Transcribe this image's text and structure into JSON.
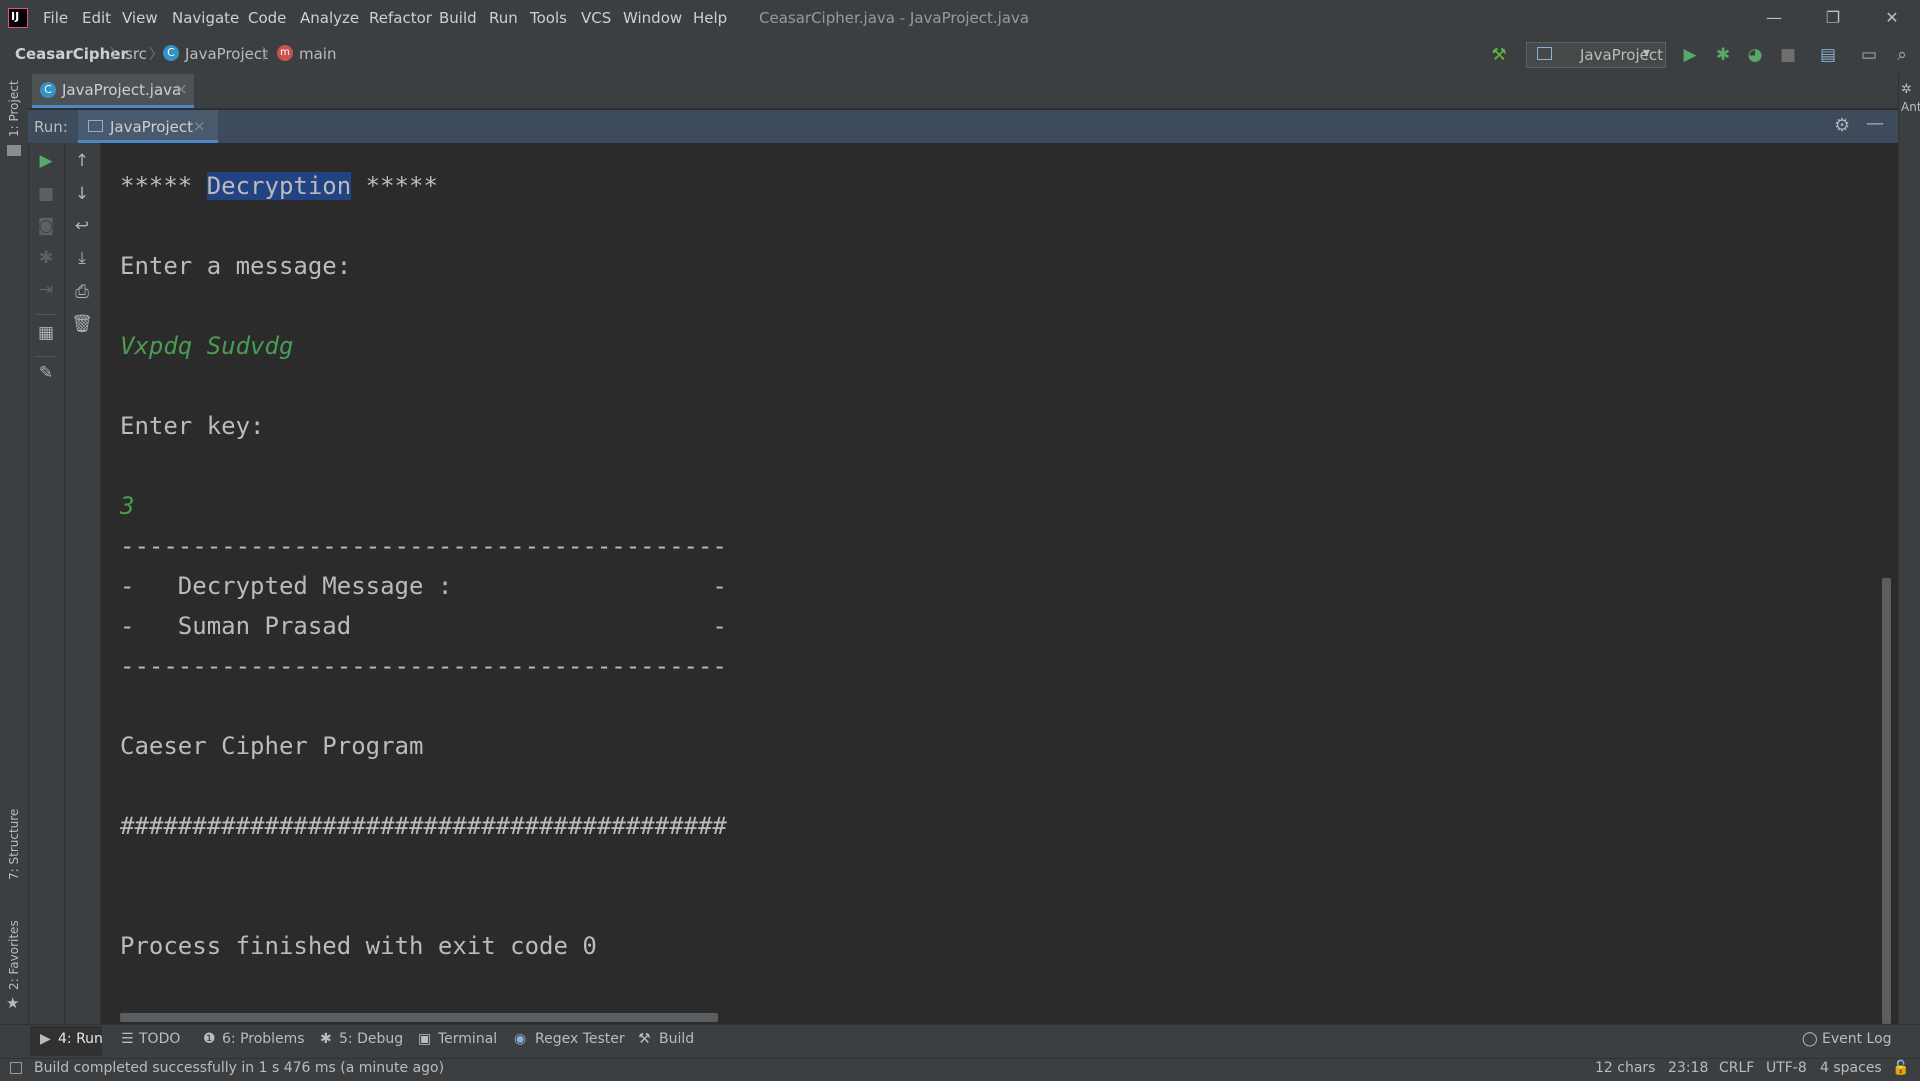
{
  "window": {
    "title": "CeasarCipher.java - JavaProject.java",
    "minimize": "—",
    "restore": "❐",
    "close": "✕"
  },
  "menu": [
    "File",
    "Edit",
    "View",
    "Navigate",
    "Code",
    "Analyze",
    "Refactor",
    "Build",
    "Run",
    "Tools",
    "VCS",
    "Window",
    "Help"
  ],
  "breadcrumb": {
    "project": "CeasarCipher",
    "folder": "src",
    "class": "JavaProject",
    "method": "main"
  },
  "toolbar": {
    "run_config": "JavaProject",
    "dropdown": "▾"
  },
  "editor_tab": {
    "label": "JavaProject.java",
    "close": "×"
  },
  "left_strip": {
    "project": "1: Project",
    "structure": "7: Structure",
    "favorites": "2: Favorites"
  },
  "right_strip": {
    "ant": "Ant"
  },
  "run_window": {
    "label": "Run:",
    "tab": "JavaProject",
    "close": "×"
  },
  "console": {
    "header_prefix": "***** ",
    "header_selected": "Decryption",
    "header_suffix": " *****",
    "prompt_message": "Enter a message:",
    "input_message": "Vxpdq Sudvdg",
    "prompt_key": "Enter key:",
    "input_key": "3",
    "divider_top": "------------------------------------------",
    "result_label": "-   Decrypted Message :                  -",
    "result_value": "-   Suman Prasad                         -",
    "divider_bottom": "------------------------------------------",
    "program_name": "Caeser Cipher Program",
    "hash_line": "##########################################",
    "process_finished": "Process finished with exit code 0"
  },
  "bottom_tools": {
    "run": "4: Run",
    "todo": "TODO",
    "problems": "6: Problems",
    "debug": "5: Debug",
    "terminal": "Terminal",
    "regex": "Regex Tester",
    "build": "Build",
    "event_log": "Event Log"
  },
  "status": {
    "message": "Build completed successfully in 1 s 476 ms (a minute ago)",
    "chars": "12 chars",
    "position": "23:18",
    "line_sep": "CRLF",
    "encoding": "UTF-8",
    "indent": "4 spaces"
  },
  "colors": {
    "background": "#2b2b2b",
    "panel": "#3c3f41",
    "run_header": "#3d4b5c",
    "selection": "#214283",
    "input_green": "#499c54",
    "accent": "#4a88c7"
  }
}
